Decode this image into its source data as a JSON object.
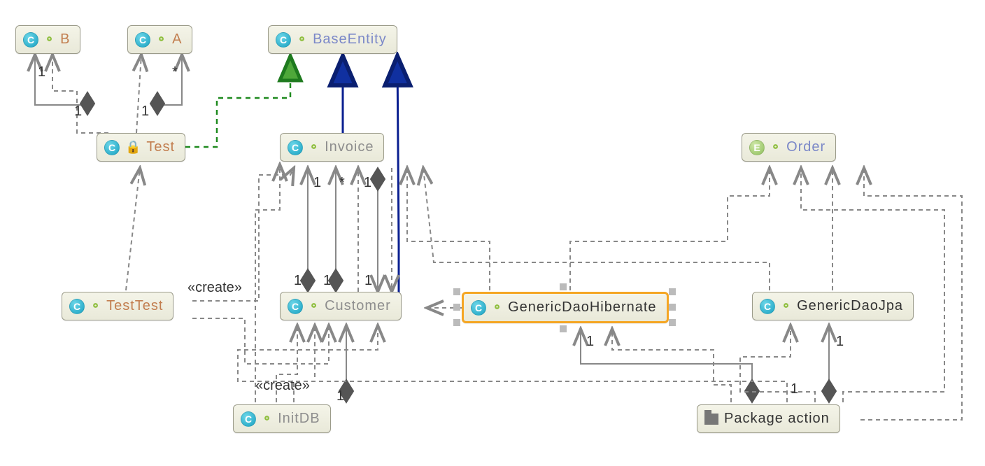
{
  "nodes": {
    "b": {
      "label": "B",
      "type": "C",
      "visibility": "pkg"
    },
    "a": {
      "label": "A",
      "type": "C",
      "visibility": "pkg"
    },
    "baseentity": {
      "label": "BaseEntity",
      "type": "C",
      "visibility": "pkg"
    },
    "test": {
      "label": "Test",
      "type": "C",
      "visibility": "priv"
    },
    "invoice": {
      "label": "Invoice",
      "type": "C",
      "visibility": "pkg"
    },
    "order": {
      "label": "Order",
      "type": "E",
      "visibility": "pkg"
    },
    "testtest": {
      "label": "TestTest",
      "type": "C",
      "visibility": "pkg"
    },
    "customer": {
      "label": "Customer",
      "type": "C",
      "visibility": "pkg"
    },
    "genericdaohibernate": {
      "label": "GenericDaoHibernate",
      "type": "C",
      "visibility": "pkg"
    },
    "genericdaojpa": {
      "label": "GenericDaoJpa",
      "type": "C",
      "visibility": "pkg"
    },
    "initdb": {
      "label": "InitDB",
      "type": "C",
      "visibility": "pkg"
    },
    "packageaction": {
      "label": "Package action",
      "type": "P",
      "visibility": ""
    }
  },
  "labels": {
    "create1": "«create»",
    "create2": "«create»",
    "one_b": "1",
    "one_test_b": "1",
    "one_test_a": "1",
    "star_a": "*",
    "one_inv1": "1",
    "one_inv2": "1",
    "star_inv": "*",
    "one_cust1": "1",
    "one_cust2": "1",
    "one_cust3": "1",
    "one_cust_initdb": "1",
    "one_gdhib": "1",
    "one_gdjpa": "1",
    "one_pkg_jpa": "1"
  },
  "selection": "genericdaohibernate"
}
